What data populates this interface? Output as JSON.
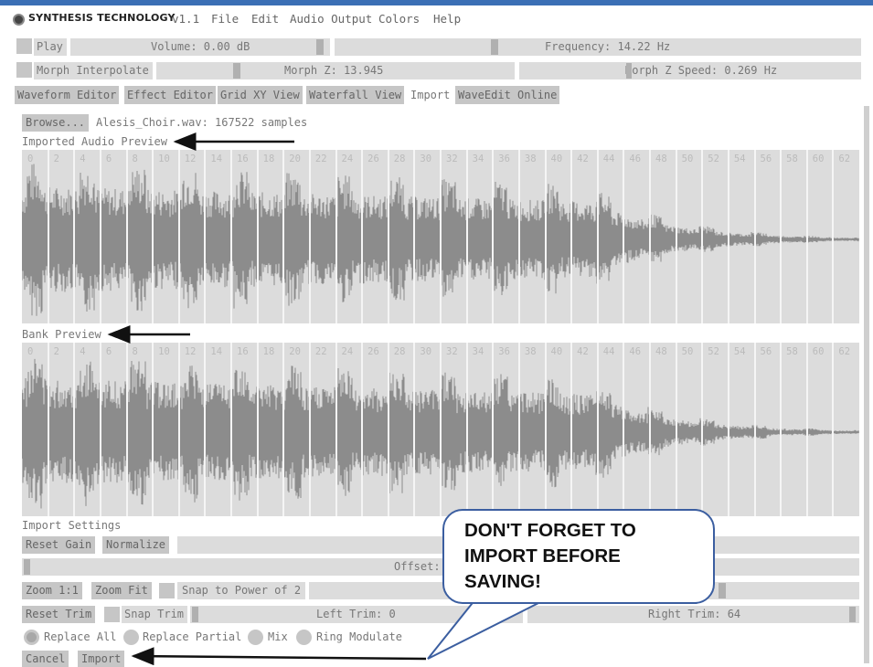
{
  "app": {
    "brand": "SYNTHESIS TECHNOLOGY",
    "version": "v1.1",
    "menu": [
      "File",
      "Edit",
      "Audio Output",
      "Colors",
      "Help"
    ]
  },
  "transport": {
    "play_label": "Play",
    "volume_label": "Volume: 0.00 dB",
    "frequency_label": "Frequency: 14.22 Hz"
  },
  "morph": {
    "interpolate_label": "Morph Interpolate",
    "z_label": "Morph Z: 13.945",
    "z_speed_label": "Morph Z Speed: 0.269 Hz"
  },
  "tabs": [
    {
      "label": "Waveform Editor",
      "active": false
    },
    {
      "label": "Effect Editor",
      "active": false
    },
    {
      "label": "Grid XY View",
      "active": false
    },
    {
      "label": "Waterfall View",
      "active": false
    },
    {
      "label": "Import",
      "active": true
    },
    {
      "label": "WaveEdit Online",
      "active": false
    }
  ],
  "import": {
    "browse_label": "Browse...",
    "file_info": "Alesis_Choir.wav: 167522 samples",
    "audio_preview_label": "Imported Audio Preview",
    "bank_preview_label": "Bank Preview",
    "tick_labels": [
      "0",
      "2",
      "4",
      "6",
      "8",
      "10",
      "12",
      "14",
      "16",
      "18",
      "20",
      "22",
      "24",
      "26",
      "28",
      "30",
      "32",
      "34",
      "36",
      "38",
      "40",
      "42",
      "44",
      "46",
      "48",
      "50",
      "52",
      "54",
      "56",
      "58",
      "60",
      "62"
    ],
    "settings_label": "Import Settings",
    "reset_gain_label": "Reset Gain",
    "normalize_label": "Normalize",
    "offset_label": "Offset:",
    "zoom_1_1_label": "Zoom 1:1",
    "zoom_fit_label": "Zoom Fit",
    "snap_power_label": "Snap to Power of 2",
    "reset_trim_label": "Reset Trim",
    "snap_trim_label": "Snap Trim",
    "left_trim_label": "Left Trim: 0",
    "right_trim_label": "Right Trim: 64",
    "modes": [
      {
        "label": "Replace All",
        "selected": true
      },
      {
        "label": "Replace Partial",
        "selected": false
      },
      {
        "label": "Mix",
        "selected": false
      },
      {
        "label": "Ring Modulate",
        "selected": false
      }
    ],
    "cancel_label": "Cancel",
    "import_label": "Import"
  },
  "callout": {
    "lines": [
      "DON'T FORGET TO",
      "IMPORT BEFORE",
      "SAVING!"
    ]
  },
  "colors": {
    "panel": "#dcdcdc",
    "button": "#c6c6c6",
    "waveform": "#8c8c8c",
    "callout_border": "#3b5ea0"
  }
}
